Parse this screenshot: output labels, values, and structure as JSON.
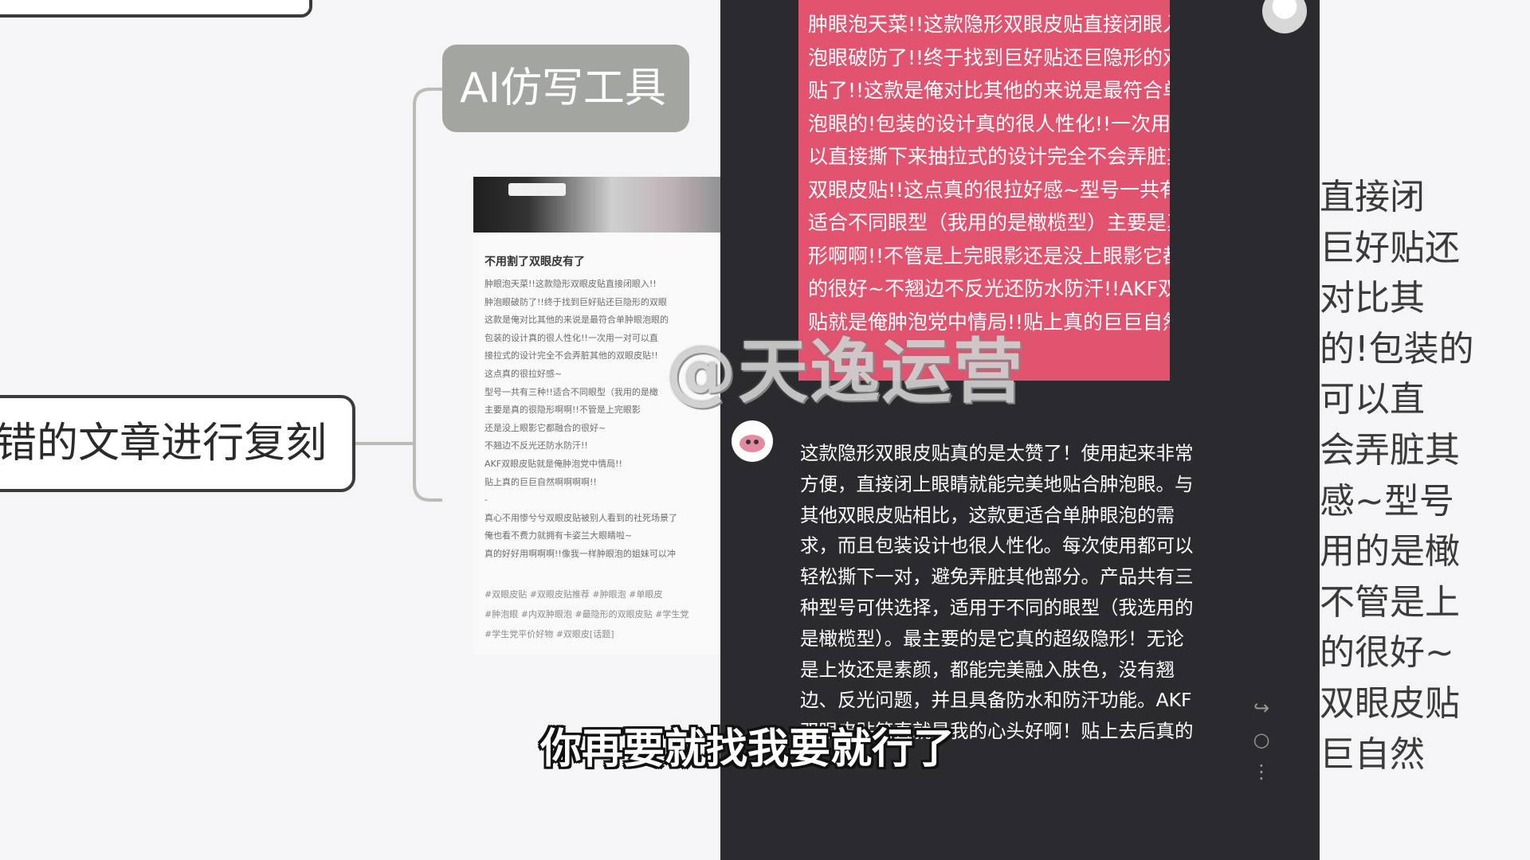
{
  "mindmap": {
    "nodes": {
      "ai_tool": "AI仿写工具",
      "root": "错的文章进行复刻"
    },
    "article": {
      "title": "不用割了双眼皮有了",
      "lines": [
        "肿眼泡天菜!!这款隐形双眼皮贴直接闭眼入!!",
        "肿泡眼破防了!!终于找到巨好贴还巨隐形的双眼",
        "这款是俺对比其他的来说是最符合单肿眼泡眼的",
        "包装的设计真的很人性化!!一次用一对可以直",
        "接拉式的设计完全不会弄脏其他的双眼皮贴!!",
        "这点真的很拉好感~",
        "型号一共有三种!!适合不同眼型（我用的是橄",
        "主要是真的很隐形啊啊!!不管是上完眼影",
        "还是没上眼影它都融合的很好~",
        "不翘边不反光还防水防汗!!",
        "AKF双眼皮贴就是俺肿泡党中情局!!",
        "贴上真的巨巨自然啊啊啊啊!!",
        "-",
        "真心不用惨兮兮双眼皮贴被别人看到的社死场景了",
        "俺也看不费力就拥有卡姿兰大眼睛啦~",
        "真的好好用啊啊啊!!像我一样肿眼泡的姐妹可以冲"
      ],
      "tags": [
        "#双眼皮贴 #双眼皮贴推荐 #肿眼泡 #单眼皮",
        "#肿泡眼 #内双肿眼泡 #最隐形的双眼皮贴 #学生党",
        "#学生党平价好物 #双眼皮[话题]"
      ]
    }
  },
  "panel": {
    "original_text": [
      "肿眼泡天菜!!这款隐形双眼皮贴直接闭眼入!!肿",
      "泡眼破防了!!终于找到巨好贴还巨隐形的双眼皮",
      "贴了!!这款是俺对比其他的来说是最符合单肿眼",
      "泡眼的!包装的设计真的很人性化!!一次用一对可",
      "以直接撕下来抽拉式的设计完全不会弄脏其他的",
      "双眼皮贴!!这点真的很拉好感~型号一共有三种!!",
      "适合不同眼型（我用的是橄榄型）主要是真的很隐",
      "形啊啊!!不管是上完眼影还是没上眼影它都融合",
      "的很好~不翘边不反光还防水防汗!!AKF双眼皮",
      "贴就是俺肿泡党中情局!!贴上真的巨巨自然啊啊啊"
    ],
    "rewritten_text": [
      "这款隐形双眼皮贴真的是太赞了！使用起来非常",
      "方便，直接闭上眼睛就能完美地贴合肿泡眼。与",
      "其他双眼皮贴相比，这款更适合单肿眼泡的需",
      "求，而且包装设计也很人性化。每次使用都可以",
      "轻松撕下一对，避免弄脏其他部分。产品共有三",
      "种型号可供选择，适用于不同的眼型（我选用的",
      "是橄榄型）。最主要的是它真的超级隐形！无论",
      "是上妆还是素颜，都能完美融入肤色，没有翘",
      "边、反光问题，并且具备防水和防汗功能。AKF",
      "双眼皮贴简直就是我的心头好啊！贴上去后真的"
    ],
    "side_actions": [
      "↪",
      "○",
      "⋮"
    ]
  },
  "right_column": [
    "直接闭",
    "巨好贴还",
    "对比其",
    "的!包装的",
    "可以直",
    "会弄脏其",
    "感~型号",
    "用的是橄",
    "不管是上",
    "的很好~",
    "双眼皮贴",
    "巨自然"
  ],
  "overlay": {
    "watermark": "@天逸运营",
    "subtitle": "你再要就找我要就行了"
  },
  "colors": {
    "pink_box": "#e2536f",
    "dark_panel": "#2b2a2e",
    "ai_node": "#a2a5a0"
  }
}
